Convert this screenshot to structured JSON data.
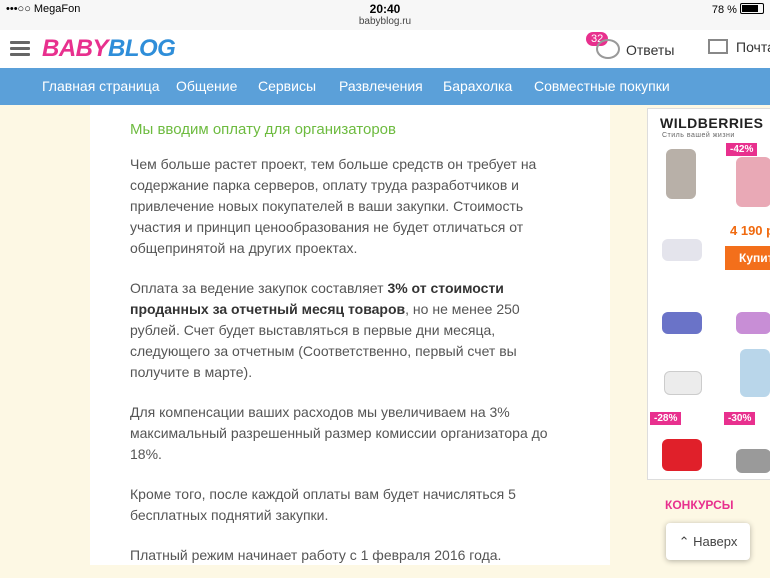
{
  "status": {
    "carrier": "•••○○ MegaFon",
    "time": "20:40",
    "url": "babyblog.ru",
    "battery": "78 %"
  },
  "header": {
    "logo_baby": "BABY",
    "logo_blog": "BLOG",
    "answers_count": "32",
    "answers_label": "Ответы",
    "mail_label": "Почта"
  },
  "nav": {
    "items": [
      "Главная страница",
      "Общение",
      "Сервисы",
      "Развлечения",
      "Барахолка",
      "Совместные покупки"
    ]
  },
  "article": {
    "title": "Мы вводим оплату для организаторов",
    "p1": "Чем больше растет проект, тем больше средств он требует на содержание парка серверов, оплату труда разработчиков и привлечение новых покупателей в ваши закупки. Стоимость участия и принцип ценообразования не будет отличаться от общепринятой на других проектах.",
    "p2_before": "Оплата за ведение закупок составляет ",
    "p2_bold": "3% от стоимости проданных за отчетный месяц товаров",
    "p2_after": ", но не менее 250 рублей. Счет будет выставляться в первые дни месяца, следующего за отчетным (Соответственно, первый счет вы получите в марте).",
    "p3": "Для компенсации ваших расходов мы увеличиваем на 3% максимальный разрешенный размер комиссии организатора до 18%.",
    "p4": "Кроме того, после каждой оплаты вам будет начисляться 5 бесплатных поднятий закупки.",
    "p5": "Платный режим начинает работу с 1 февраля 2016 года."
  },
  "ad": {
    "brand": "WILDBERRIES",
    "slogan": "Стиль вашей жизни",
    "discount1": "-42%",
    "price": "4 190 р",
    "buy": "Купит",
    "discount2": "-28%",
    "discount3": "-30%"
  },
  "sidebar": {
    "contests": "КОНКУРСЫ"
  },
  "back_to_top": "⌃ Наверх"
}
